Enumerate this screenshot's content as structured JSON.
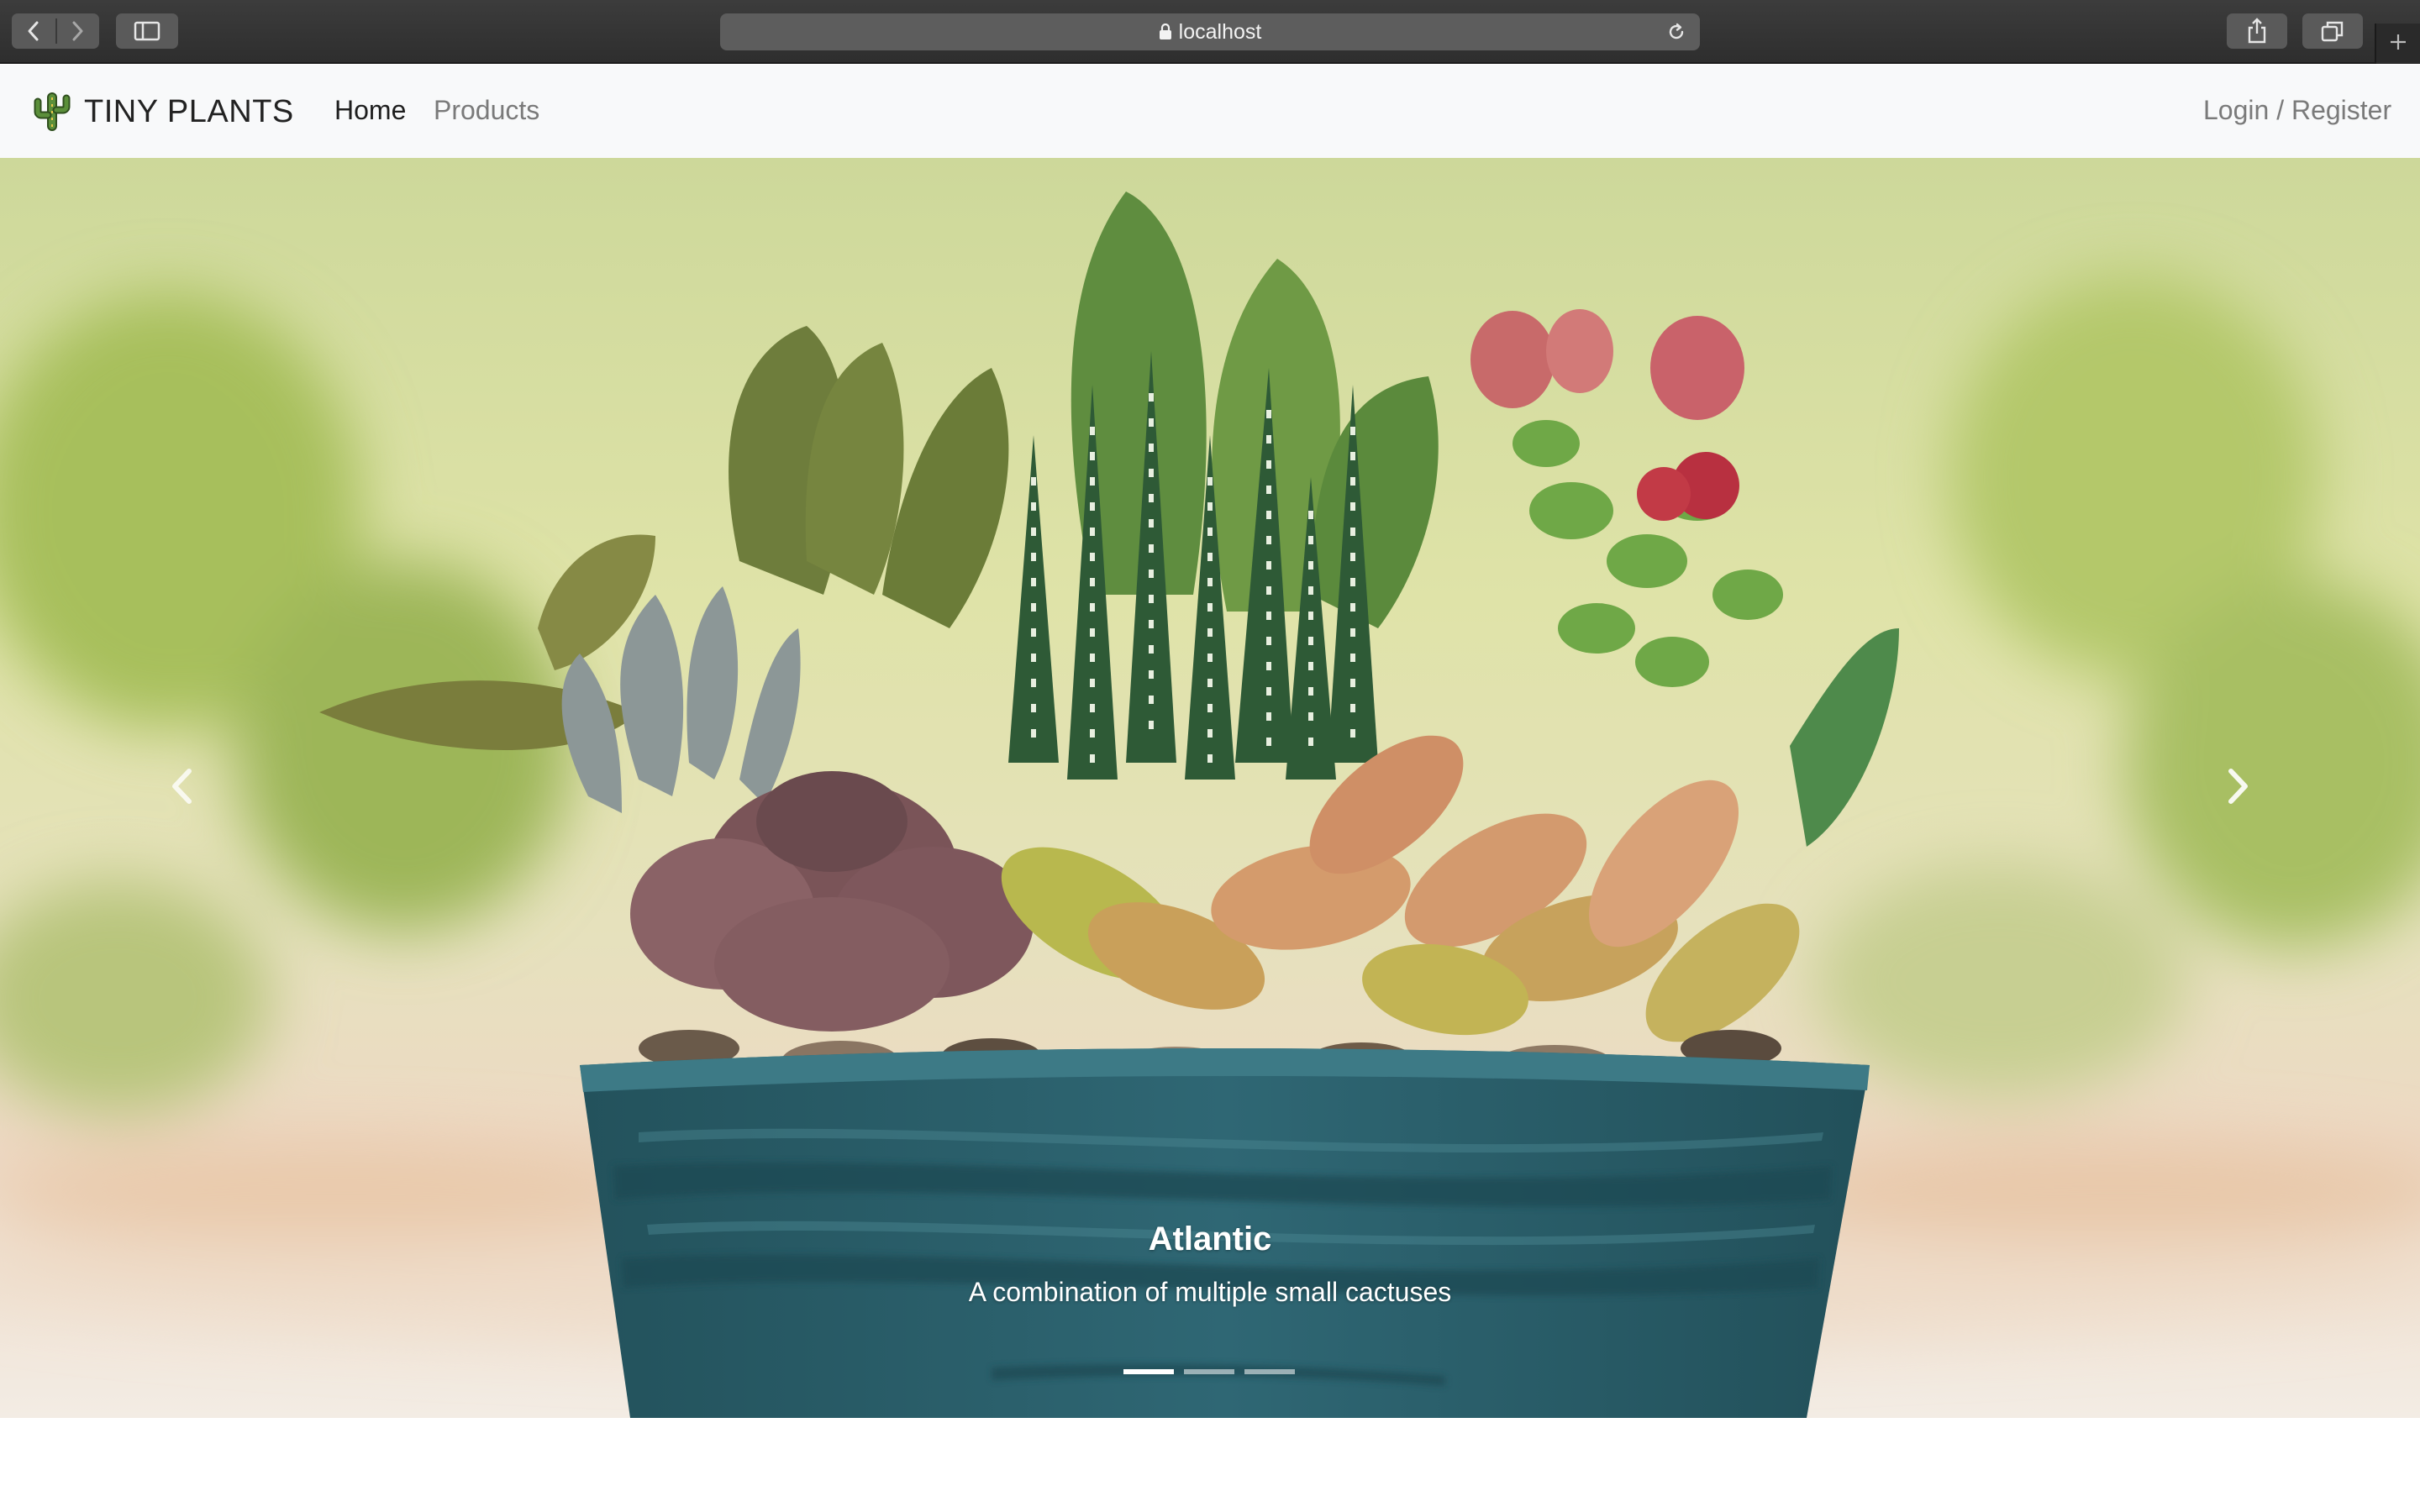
{
  "browser": {
    "url": "localhost",
    "icons": {
      "back": "chevron-left-icon",
      "forward": "chevron-right-icon",
      "sidebar": "sidebar-icon",
      "lock": "lock-icon",
      "reload": "reload-icon",
      "share": "share-icon",
      "tabs": "tabs-overview-icon",
      "new_tab": "plus-icon"
    }
  },
  "navbar": {
    "brand": "TINY PLANTS",
    "brand_icon": "cactus-icon",
    "links": [
      "Home",
      "Products"
    ],
    "active_link": "Home",
    "auth_link": "Login / Register"
  },
  "carousel": {
    "slide": {
      "title": "Atlantic",
      "description": "A combination of multiple small cactuses"
    },
    "indicator_count": 3,
    "active_indicator": 0,
    "prev_icon": "chevron-left-icon",
    "next_icon": "chevron-right-icon"
  },
  "colors": {
    "navbar_bg": "#f8f9fa",
    "pot": "#2c6470",
    "brand_text": "#222222",
    "muted_link": "#7a7a7a"
  }
}
